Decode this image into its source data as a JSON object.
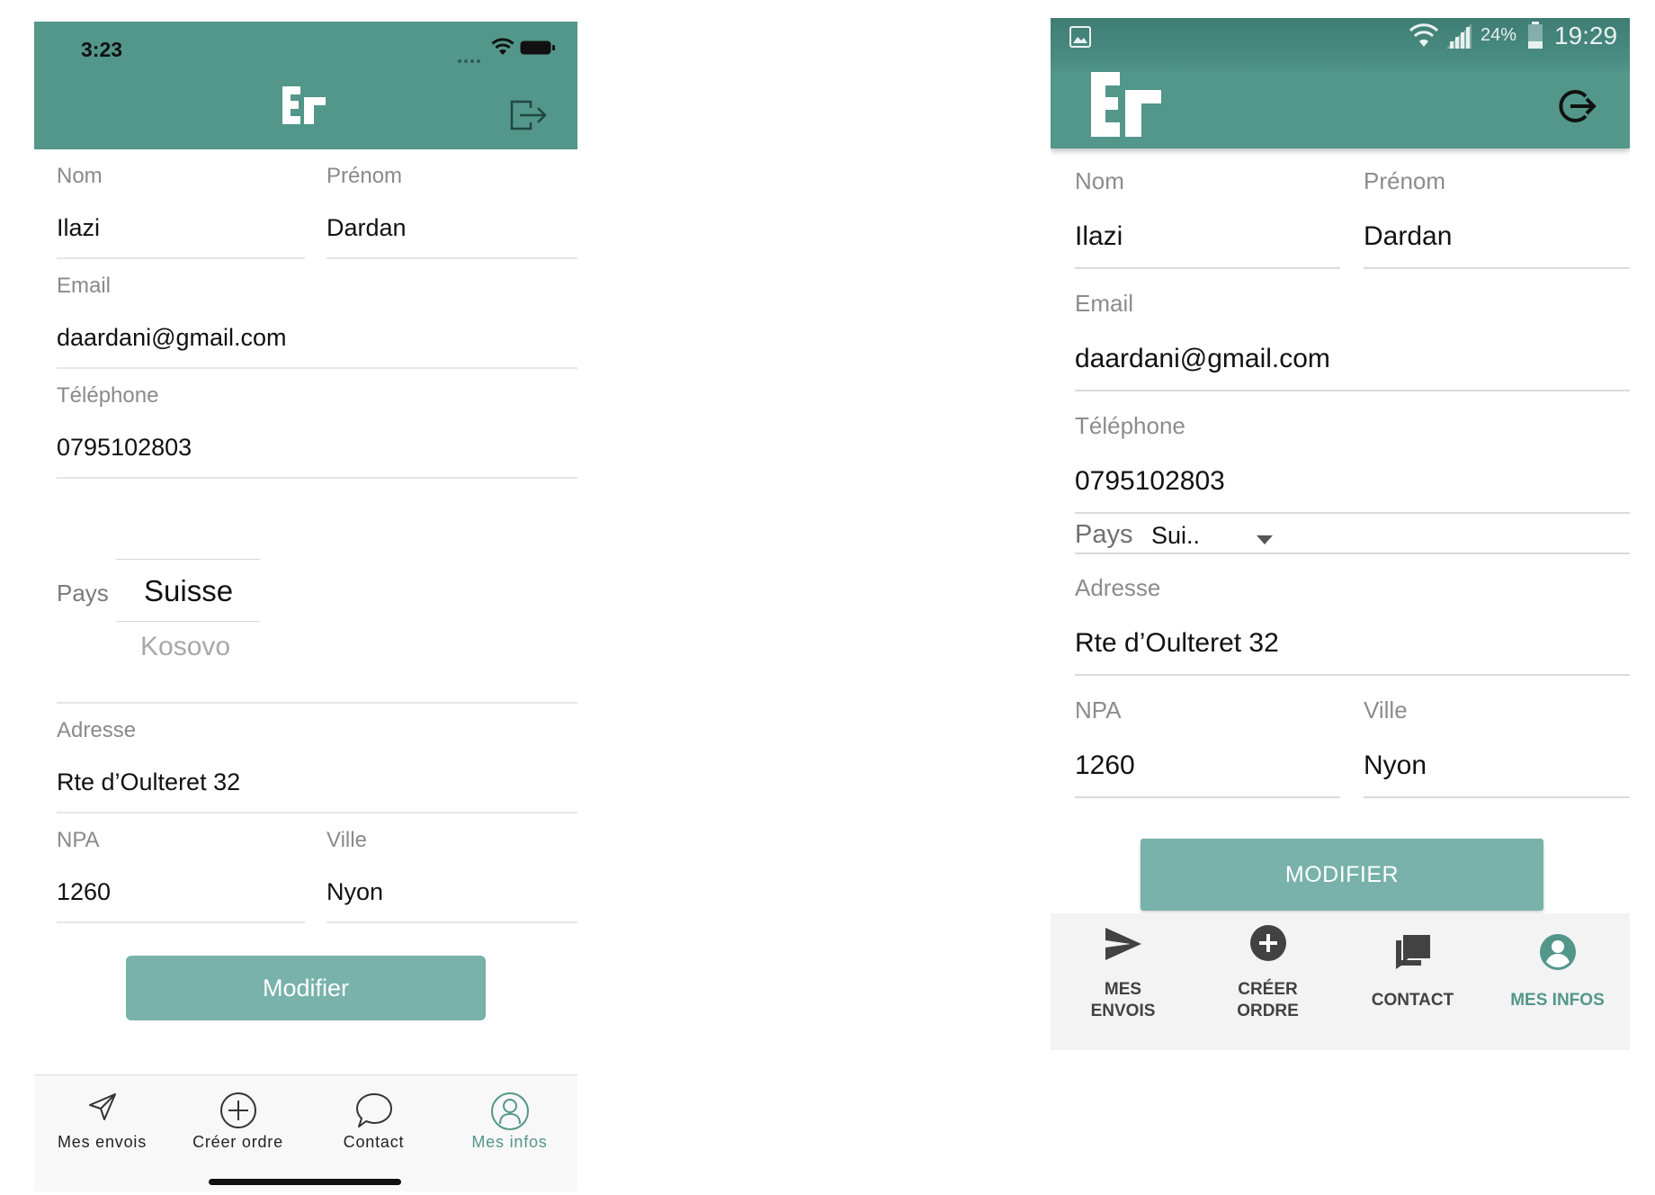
{
  "ios": {
    "status": {
      "time": "3:23",
      "signal_icon": "dots-signal-icon",
      "wifi_icon": "wifi-icon",
      "battery_icon": "battery-icon"
    },
    "header": {
      "logo_text": "Er",
      "logout_icon": "logout-icon"
    },
    "form": {
      "nom_label": "Nom",
      "nom_value": "Ilazi",
      "prenom_label": "Prénom",
      "prenom_value": "Dardan",
      "email_label": "Email",
      "email_value": "daardani@gmail.com",
      "telephone_label": "Téléphone",
      "telephone_value": "0795102803",
      "pays_label": "Pays",
      "pays_selected": "Suisse",
      "pays_next_option": "Kosovo",
      "adresse_label": "Adresse",
      "adresse_value": "Rte d’Oulteret 32",
      "npa_label": "NPA",
      "npa_value": "1260",
      "ville_label": "Ville",
      "ville_value": "Nyon"
    },
    "button_label": "Modifier",
    "tabs": [
      {
        "label": "Mes envois",
        "icon": "send-icon"
      },
      {
        "label": "Créer ordre",
        "icon": "plus-circle-icon"
      },
      {
        "label": "Contact",
        "icon": "chat-bubble-icon"
      },
      {
        "label": "Mes infos",
        "icon": "user-circle-icon",
        "active": true
      }
    ],
    "accent_color": "#53968a",
    "button_color": "#78b2aa"
  },
  "android": {
    "status": {
      "image_icon": "image-icon",
      "wifi_icon": "wifi-icon",
      "signal_icon": "signal-bars-icon",
      "battery_percent": "24%",
      "battery_icon": "battery-icon",
      "time": "19:29"
    },
    "header": {
      "logo_text": "Er",
      "logout_icon": "logout-icon"
    },
    "form": {
      "nom_label": "Nom",
      "nom_value": "Ilazi",
      "prenom_label": "Prénom",
      "prenom_value": "Dardan",
      "email_label": "Email",
      "email_value": "daardani@gmail.com",
      "telephone_label": "Téléphone",
      "telephone_value": "0795102803",
      "pays_label": "Pays",
      "pays_value": "Sui..",
      "adresse_label": "Adresse",
      "adresse_value": "Rte d’Oulteret 32",
      "npa_label": "NPA",
      "npa_value": "1260",
      "ville_label": "Ville",
      "ville_value": "Nyon"
    },
    "button_label": "MODIFIER",
    "tabs": [
      {
        "line1": "MES",
        "line2": "ENVOIS",
        "icon": "send-icon"
      },
      {
        "line1": "CRÉER",
        "line2": "ORDRE",
        "icon": "plus-circle-icon"
      },
      {
        "line1": "CONTACT",
        "icon": "chat-icon"
      },
      {
        "line1": "MES INFOS",
        "icon": "account-circle-icon",
        "active": true
      }
    ],
    "accent_color": "#53968a",
    "button_color": "#78b2aa"
  }
}
